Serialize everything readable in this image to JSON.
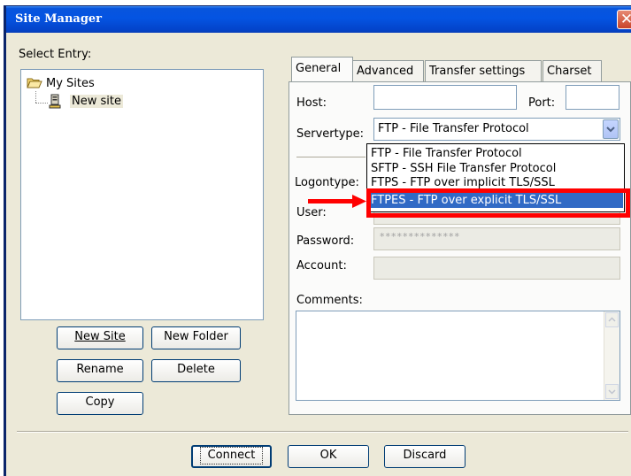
{
  "window": {
    "title": "Site Manager",
    "close_glyph": "✕"
  },
  "tree": {
    "select_entry_label": "Select Entry:",
    "root_label": "My Sites",
    "child_label": "New site"
  },
  "left_buttons": {
    "new_site": "New Site",
    "new_folder": "New Folder",
    "rename": "Rename",
    "delete": "Delete",
    "copy": "Copy"
  },
  "tabs": [
    {
      "label": "General",
      "active": true
    },
    {
      "label": "Advanced",
      "active": false
    },
    {
      "label": "Transfer settings",
      "active": false
    },
    {
      "label": "Charset",
      "active": false
    }
  ],
  "general": {
    "host_label": "Host:",
    "host_value": "",
    "port_label": "Port:",
    "port_value": "",
    "servertype_label": "Servertype:",
    "servertype_value": "FTP - File Transfer Protocol",
    "logontype_label": "Logontype:",
    "user_label": "User:",
    "password_label": "Password:",
    "password_mask": "**************",
    "account_label": "Account:",
    "comments_label": "Comments:"
  },
  "servertype_options": [
    {
      "label": "FTP - File Transfer Protocol",
      "selected": false
    },
    {
      "label": "SFTP - SSH File Transfer Protocol",
      "selected": false
    },
    {
      "label": "FTPS - FTP over implicit TLS/SSL",
      "selected": false
    },
    {
      "label": "FTPES - FTP over explicit TLS/SSL",
      "selected": true
    }
  ],
  "bottom_buttons": {
    "connect": "Connect",
    "ok": "OK",
    "discard": "Discard"
  },
  "annotation": {
    "arrow_color": "#ff0000",
    "box_color": "#ff0000"
  },
  "colors": {
    "titlebar": "#0454e2",
    "selection": "#316ac5",
    "dialog_bg": "#ece9d8"
  }
}
